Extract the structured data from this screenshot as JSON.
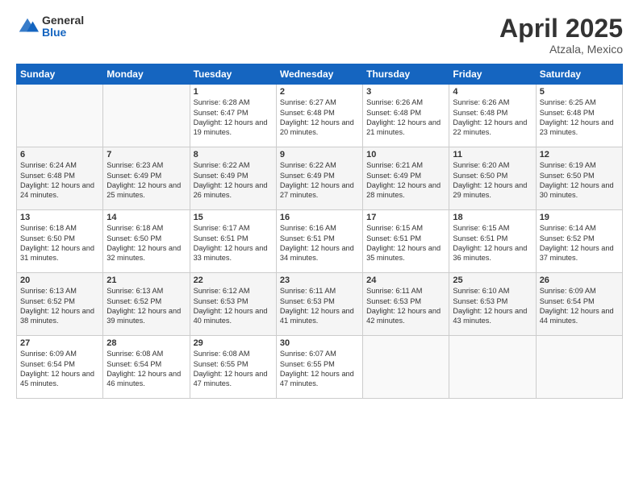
{
  "header": {
    "logo_general": "General",
    "logo_blue": "Blue",
    "month": "April 2025",
    "location": "Atzala, Mexico"
  },
  "weekdays": [
    "Sunday",
    "Monday",
    "Tuesday",
    "Wednesday",
    "Thursday",
    "Friday",
    "Saturday"
  ],
  "weeks": [
    [
      {
        "day": "",
        "sunrise": "",
        "sunset": "",
        "daylight": ""
      },
      {
        "day": "",
        "sunrise": "",
        "sunset": "",
        "daylight": ""
      },
      {
        "day": "1",
        "sunrise": "Sunrise: 6:28 AM",
        "sunset": "Sunset: 6:47 PM",
        "daylight": "Daylight: 12 hours and 19 minutes."
      },
      {
        "day": "2",
        "sunrise": "Sunrise: 6:27 AM",
        "sunset": "Sunset: 6:48 PM",
        "daylight": "Daylight: 12 hours and 20 minutes."
      },
      {
        "day": "3",
        "sunrise": "Sunrise: 6:26 AM",
        "sunset": "Sunset: 6:48 PM",
        "daylight": "Daylight: 12 hours and 21 minutes."
      },
      {
        "day": "4",
        "sunrise": "Sunrise: 6:26 AM",
        "sunset": "Sunset: 6:48 PM",
        "daylight": "Daylight: 12 hours and 22 minutes."
      },
      {
        "day": "5",
        "sunrise": "Sunrise: 6:25 AM",
        "sunset": "Sunset: 6:48 PM",
        "daylight": "Daylight: 12 hours and 23 minutes."
      }
    ],
    [
      {
        "day": "6",
        "sunrise": "Sunrise: 6:24 AM",
        "sunset": "Sunset: 6:48 PM",
        "daylight": "Daylight: 12 hours and 24 minutes."
      },
      {
        "day": "7",
        "sunrise": "Sunrise: 6:23 AM",
        "sunset": "Sunset: 6:49 PM",
        "daylight": "Daylight: 12 hours and 25 minutes."
      },
      {
        "day": "8",
        "sunrise": "Sunrise: 6:22 AM",
        "sunset": "Sunset: 6:49 PM",
        "daylight": "Daylight: 12 hours and 26 minutes."
      },
      {
        "day": "9",
        "sunrise": "Sunrise: 6:22 AM",
        "sunset": "Sunset: 6:49 PM",
        "daylight": "Daylight: 12 hours and 27 minutes."
      },
      {
        "day": "10",
        "sunrise": "Sunrise: 6:21 AM",
        "sunset": "Sunset: 6:49 PM",
        "daylight": "Daylight: 12 hours and 28 minutes."
      },
      {
        "day": "11",
        "sunrise": "Sunrise: 6:20 AM",
        "sunset": "Sunset: 6:50 PM",
        "daylight": "Daylight: 12 hours and 29 minutes."
      },
      {
        "day": "12",
        "sunrise": "Sunrise: 6:19 AM",
        "sunset": "Sunset: 6:50 PM",
        "daylight": "Daylight: 12 hours and 30 minutes."
      }
    ],
    [
      {
        "day": "13",
        "sunrise": "Sunrise: 6:18 AM",
        "sunset": "Sunset: 6:50 PM",
        "daylight": "Daylight: 12 hours and 31 minutes."
      },
      {
        "day": "14",
        "sunrise": "Sunrise: 6:18 AM",
        "sunset": "Sunset: 6:50 PM",
        "daylight": "Daylight: 12 hours and 32 minutes."
      },
      {
        "day": "15",
        "sunrise": "Sunrise: 6:17 AM",
        "sunset": "Sunset: 6:51 PM",
        "daylight": "Daylight: 12 hours and 33 minutes."
      },
      {
        "day": "16",
        "sunrise": "Sunrise: 6:16 AM",
        "sunset": "Sunset: 6:51 PM",
        "daylight": "Daylight: 12 hours and 34 minutes."
      },
      {
        "day": "17",
        "sunrise": "Sunrise: 6:15 AM",
        "sunset": "Sunset: 6:51 PM",
        "daylight": "Daylight: 12 hours and 35 minutes."
      },
      {
        "day": "18",
        "sunrise": "Sunrise: 6:15 AM",
        "sunset": "Sunset: 6:51 PM",
        "daylight": "Daylight: 12 hours and 36 minutes."
      },
      {
        "day": "19",
        "sunrise": "Sunrise: 6:14 AM",
        "sunset": "Sunset: 6:52 PM",
        "daylight": "Daylight: 12 hours and 37 minutes."
      }
    ],
    [
      {
        "day": "20",
        "sunrise": "Sunrise: 6:13 AM",
        "sunset": "Sunset: 6:52 PM",
        "daylight": "Daylight: 12 hours and 38 minutes."
      },
      {
        "day": "21",
        "sunrise": "Sunrise: 6:13 AM",
        "sunset": "Sunset: 6:52 PM",
        "daylight": "Daylight: 12 hours and 39 minutes."
      },
      {
        "day": "22",
        "sunrise": "Sunrise: 6:12 AM",
        "sunset": "Sunset: 6:53 PM",
        "daylight": "Daylight: 12 hours and 40 minutes."
      },
      {
        "day": "23",
        "sunrise": "Sunrise: 6:11 AM",
        "sunset": "Sunset: 6:53 PM",
        "daylight": "Daylight: 12 hours and 41 minutes."
      },
      {
        "day": "24",
        "sunrise": "Sunrise: 6:11 AM",
        "sunset": "Sunset: 6:53 PM",
        "daylight": "Daylight: 12 hours and 42 minutes."
      },
      {
        "day": "25",
        "sunrise": "Sunrise: 6:10 AM",
        "sunset": "Sunset: 6:53 PM",
        "daylight": "Daylight: 12 hours and 43 minutes."
      },
      {
        "day": "26",
        "sunrise": "Sunrise: 6:09 AM",
        "sunset": "Sunset: 6:54 PM",
        "daylight": "Daylight: 12 hours and 44 minutes."
      }
    ],
    [
      {
        "day": "27",
        "sunrise": "Sunrise: 6:09 AM",
        "sunset": "Sunset: 6:54 PM",
        "daylight": "Daylight: 12 hours and 45 minutes."
      },
      {
        "day": "28",
        "sunrise": "Sunrise: 6:08 AM",
        "sunset": "Sunset: 6:54 PM",
        "daylight": "Daylight: 12 hours and 46 minutes."
      },
      {
        "day": "29",
        "sunrise": "Sunrise: 6:08 AM",
        "sunset": "Sunset: 6:55 PM",
        "daylight": "Daylight: 12 hours and 47 minutes."
      },
      {
        "day": "30",
        "sunrise": "Sunrise: 6:07 AM",
        "sunset": "Sunset: 6:55 PM",
        "daylight": "Daylight: 12 hours and 47 minutes."
      },
      {
        "day": "",
        "sunrise": "",
        "sunset": "",
        "daylight": ""
      },
      {
        "day": "",
        "sunrise": "",
        "sunset": "",
        "daylight": ""
      },
      {
        "day": "",
        "sunrise": "",
        "sunset": "",
        "daylight": ""
      }
    ]
  ]
}
